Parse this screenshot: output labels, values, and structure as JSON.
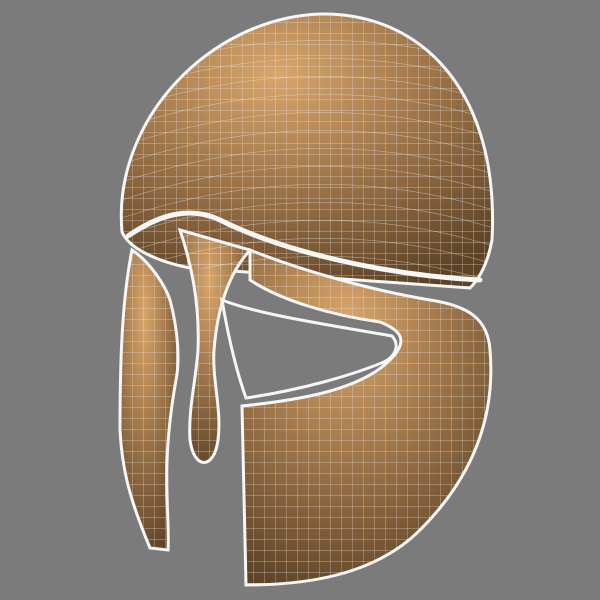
{
  "scene": {
    "subject": "helmet-wireframe-mesh",
    "colors": {
      "background": "#7b7b7b",
      "bronze_highlight": "#d9a66b",
      "bronze_mid": "#a2784b",
      "bronze_dark": "#5d4226",
      "wire": "#ececec",
      "rim": "#f6f6f6"
    }
  }
}
